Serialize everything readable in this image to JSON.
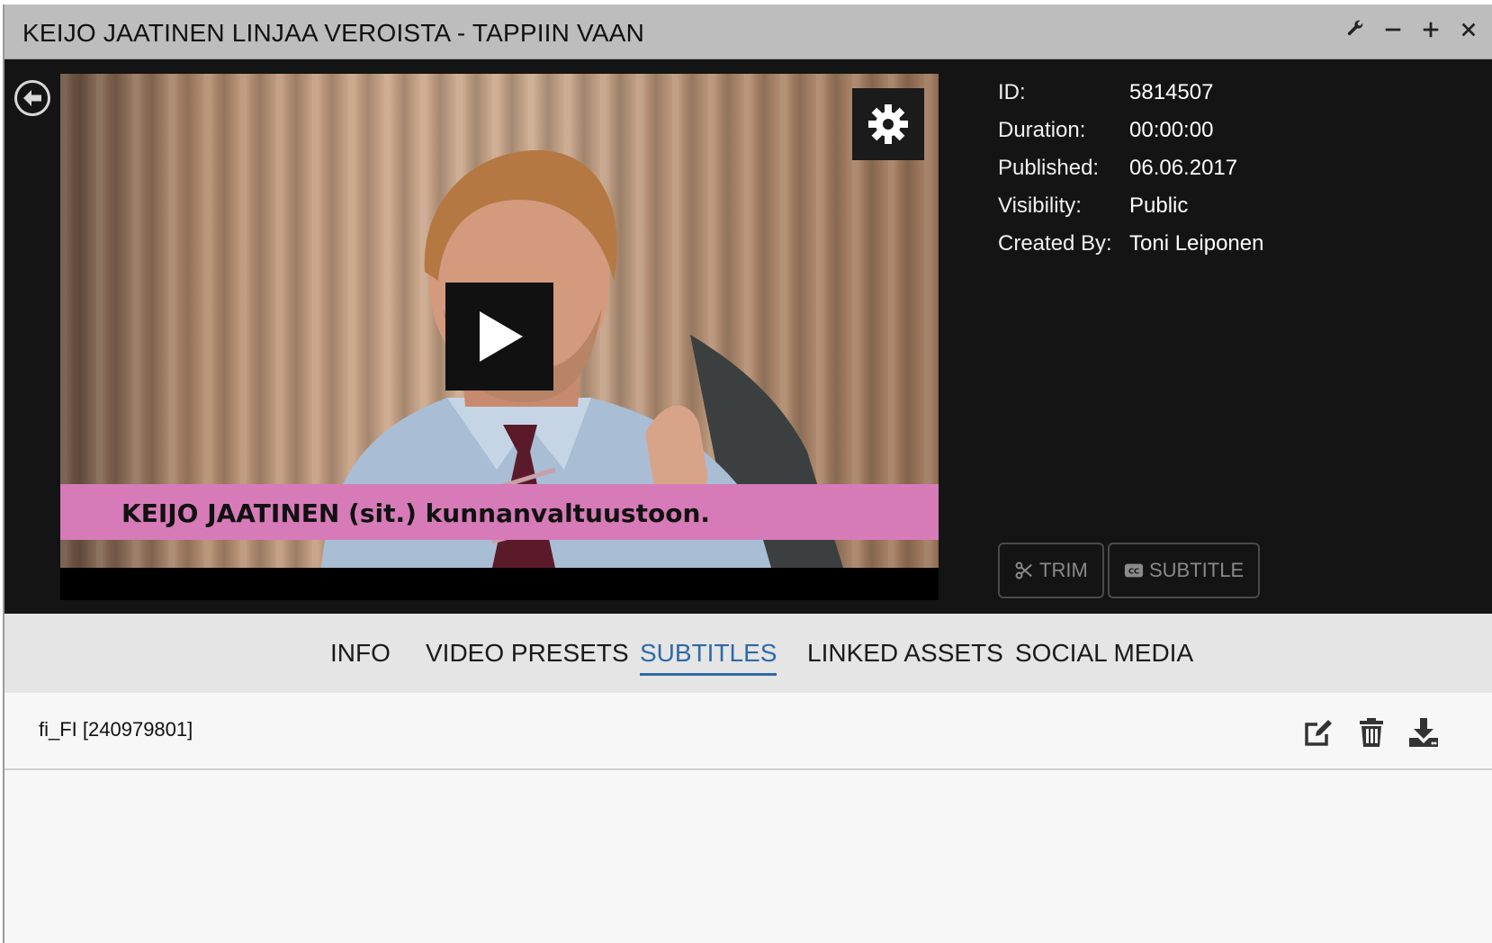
{
  "window": {
    "title": "KEIJO JAATINEN LINJAA VEROISTA - TAPPIIN VAAN",
    "controls": [
      "wrench-icon",
      "minimize-icon",
      "maximize-icon",
      "close-icon"
    ]
  },
  "player": {
    "caption": "KEIJO JAATINEN (sit.) kunnanvaltuustoon.",
    "icons": [
      "play-icon",
      "gear-icon",
      "back-arrow-icon"
    ]
  },
  "meta": [
    {
      "key": "ID:",
      "value": "5814507"
    },
    {
      "key": "Duration:",
      "value": "00:00:00"
    },
    {
      "key": "Published:",
      "value": "06.06.2017"
    },
    {
      "key": "Visibility:",
      "value": "Public"
    },
    {
      "key": "Created By:",
      "value": "Toni Leiponen"
    }
  ],
  "actions": {
    "trim": "TRIM",
    "subtitle": "SUBTITLE"
  },
  "tabs": [
    {
      "label": "INFO",
      "active": false
    },
    {
      "label": "VIDEO PRESETS",
      "active": false
    },
    {
      "label": "SUBTITLES",
      "active": true
    },
    {
      "label": "LINKED ASSETS",
      "active": false
    },
    {
      "label": "SOCIAL MEDIA",
      "active": false
    }
  ],
  "subtitles": [
    {
      "label": "fi_FI [240979801]",
      "actions": [
        "edit-icon",
        "trash-icon",
        "download-icon"
      ]
    }
  ],
  "colors": {
    "accent": "#2f6aa6",
    "titlebar": "#bdbdbd",
    "hero": "#141414",
    "caption_bar": "#d77bb8"
  }
}
